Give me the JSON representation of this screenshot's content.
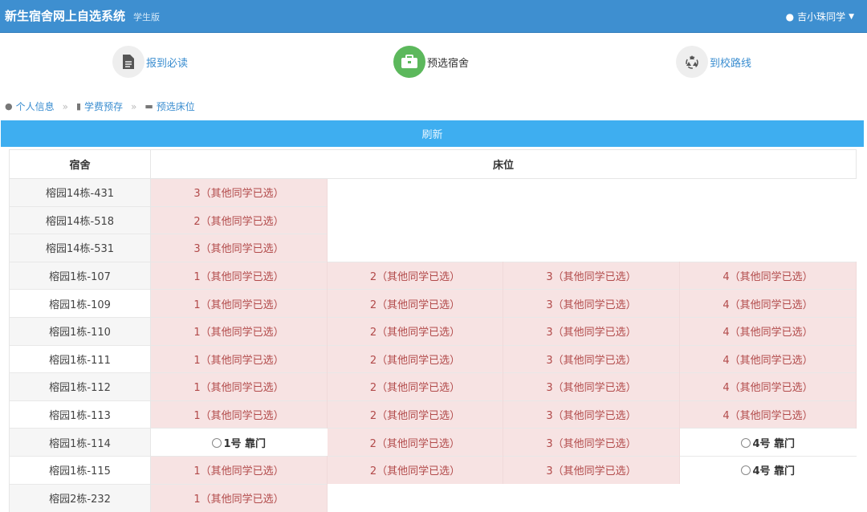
{
  "header": {
    "title": "新生宿舍网上自选系统",
    "subtitle": "学生版",
    "user": "吉小珠同学"
  },
  "steps": [
    {
      "label": "报到必读",
      "icon": "document-icon"
    },
    {
      "label": "预选宿舍",
      "icon": "briefcase-icon"
    },
    {
      "label": "到校路线",
      "icon": "recycle-icon"
    }
  ],
  "breadcrumb": [
    "个人信息",
    "学费预存",
    "预选床位"
  ],
  "refresh_label": "刷新",
  "table": {
    "headers": [
      "宿舍",
      "床位"
    ],
    "rows": [
      {
        "dorm": "榕园14栋-431",
        "beds": [
          "3（其他同学已选）"
        ]
      },
      {
        "dorm": "榕园14栋-518",
        "beds": [
          "2（其他同学已选）"
        ]
      },
      {
        "dorm": "榕园14栋-531",
        "beds": [
          "3（其他同学已选）"
        ]
      },
      {
        "dorm": "榕园1栋-107",
        "beds": [
          "1（其他同学已选）",
          "2（其他同学已选）",
          "3（其他同学已选）",
          "4（其他同学已选）"
        ]
      },
      {
        "dorm": "榕园1栋-109",
        "beds": [
          "1（其他同学已选）",
          "2（其他同学已选）",
          "3（其他同学已选）",
          "4（其他同学已选）"
        ]
      },
      {
        "dorm": "榕园1栋-110",
        "beds": [
          "1（其他同学已选）",
          "2（其他同学已选）",
          "3（其他同学已选）",
          "4（其他同学已选）"
        ]
      },
      {
        "dorm": "榕园1栋-111",
        "beds": [
          "1（其他同学已选）",
          "2（其他同学已选）",
          "3（其他同学已选）",
          "4（其他同学已选）"
        ]
      },
      {
        "dorm": "榕园1栋-112",
        "beds": [
          "1（其他同学已选）",
          "2（其他同学已选）",
          "3（其他同学已选）",
          "4（其他同学已选）"
        ]
      },
      {
        "dorm": "榕园1栋-113",
        "beds": [
          "1（其他同学已选）",
          "2（其他同学已选）",
          "3（其他同学已选）",
          "4（其他同学已选）"
        ]
      },
      {
        "dorm": "榕园1栋-114",
        "beds": [
          {
            "free": "1号 靠门"
          },
          "2（其他同学已选）",
          "3（其他同学已选）",
          {
            "free": "4号 靠门"
          }
        ]
      },
      {
        "dorm": "榕园1栋-115",
        "beds": [
          "1（其他同学已选）",
          "2（其他同学已选）",
          "3（其他同学已选）",
          {
            "free": "4号 靠门"
          }
        ]
      },
      {
        "dorm": "榕园2栋-232",
        "beds": [
          "1（其他同学已选）"
        ]
      }
    ]
  }
}
